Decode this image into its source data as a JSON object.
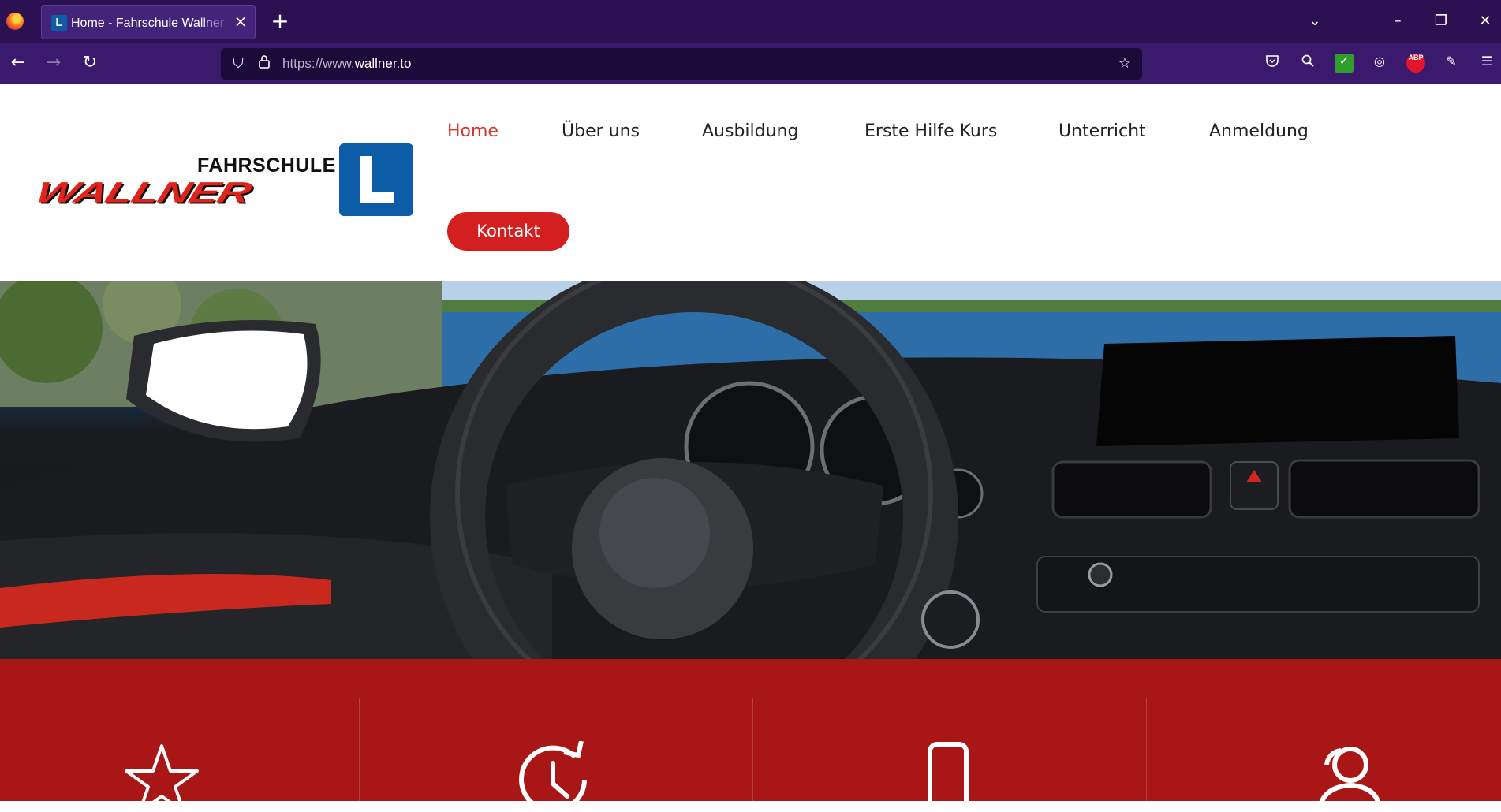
{
  "browser": {
    "tab_title": "Home - Fahrschule Wallner | Bregenz",
    "url_prefix": "https://www.",
    "url_host": "wallner.to",
    "extensions": {
      "abp_label": "ABP"
    }
  },
  "site": {
    "logo": {
      "top_word": "FAHRSCHULE",
      "main_word": "WALLNER",
      "badge_letter": "L"
    },
    "menu": [
      "Home",
      "Über uns",
      "Ausbildung",
      "Erste Hilfe Kurs",
      "Unterricht",
      "Anmeldung"
    ],
    "active_menu": "Home",
    "contact_button": "Kontakt",
    "colors": {
      "accent": "#d31f1f",
      "feature_band": "#a81616",
      "logo_blue": "#0d5ca8",
      "browser_frame": "#2b1152"
    }
  },
  "features": {
    "icons": [
      "star-icon",
      "clock-refresh-icon",
      "smartphone-icon",
      "users-icon"
    ]
  }
}
